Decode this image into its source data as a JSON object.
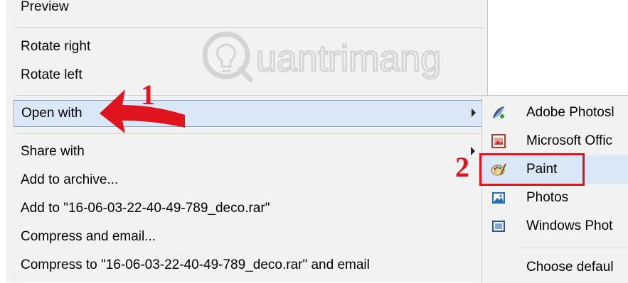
{
  "context_menu": {
    "items": [
      {
        "label": "Preview"
      },
      {
        "label": "Rotate right"
      },
      {
        "label": "Rotate left"
      },
      {
        "label": "Open with"
      },
      {
        "label": "Share with"
      },
      {
        "label": "Add to archive..."
      },
      {
        "label": "Add to \"16-06-03-22-40-49-789_deco.rar\""
      },
      {
        "label": "Compress and email..."
      },
      {
        "label": "Compress to \"16-06-03-22-40-49-789_deco.rar\" and email"
      }
    ],
    "highlight_color": "#d9e7f6",
    "highlight_border": "#7ea6d3"
  },
  "submenu": {
    "items": [
      {
        "label": "Adobe Photosl",
        "icon": "photoshop-feather-icon"
      },
      {
        "label": "Microsoft Offic",
        "icon": "office-picture-icon"
      },
      {
        "label": "Paint",
        "icon": "paint-palette-icon"
      },
      {
        "label": "Photos",
        "icon": "photos-icon"
      },
      {
        "label": "Windows Phot",
        "icon": "windows-photo-viewer-icon"
      },
      {
        "label": "Choose defaul"
      }
    ]
  },
  "annotations": {
    "step1": "1",
    "step2": "2",
    "color": "#e0141e"
  },
  "watermark": {
    "text": "uantrimang"
  }
}
